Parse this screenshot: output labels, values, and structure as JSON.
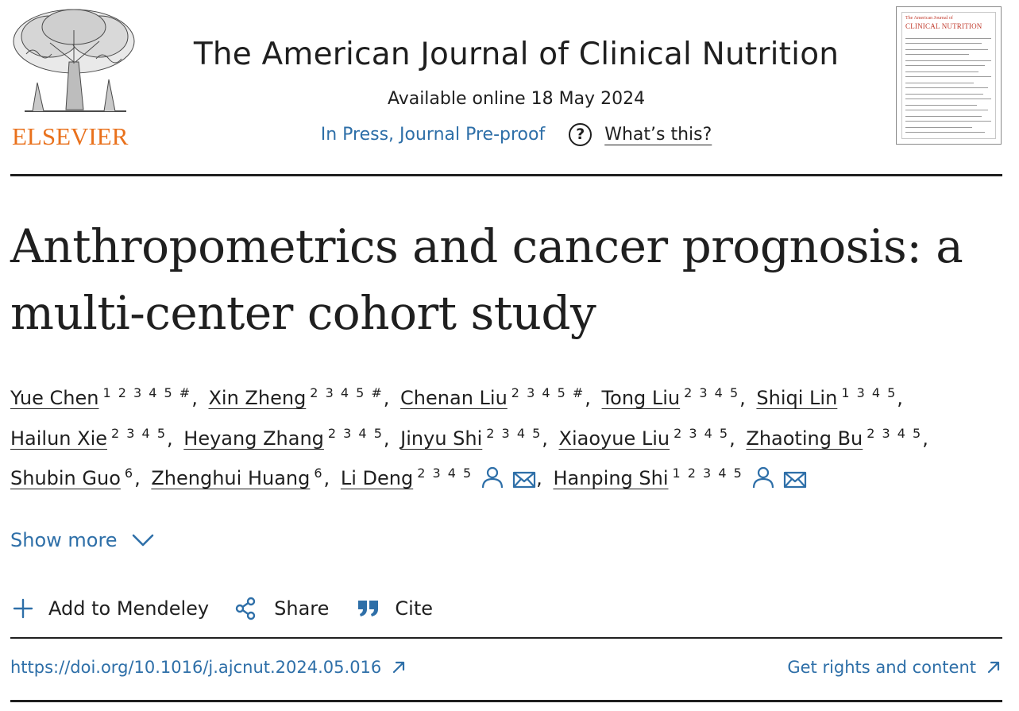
{
  "header": {
    "publisher": "ELSEVIER",
    "journal_title": "The American Journal of Clinical Nutrition",
    "available_online": "Available online 18 May 2024",
    "in_press_label": "In Press, Journal Pre-proof",
    "whats_this_label": "What’s this?",
    "help_icon_glyph": "?",
    "cover": {
      "small_title": "The American Journal of",
      "big_title": "CLINICAL NUTRITION"
    }
  },
  "article": {
    "title": "Anthropometrics and cancer prognosis: a multi-center cohort study",
    "authors": [
      {
        "name": "Yue Chen",
        "sup": "1 2 3 4 5 #",
        "icons": []
      },
      {
        "name": "Xin Zheng",
        "sup": "2 3 4 5 #",
        "icons": []
      },
      {
        "name": "Chenan Liu",
        "sup": "2 3 4 5 #",
        "icons": []
      },
      {
        "name": "Tong Liu",
        "sup": "2 3 4 5",
        "icons": []
      },
      {
        "name": "Shiqi Lin",
        "sup": "1 3 4 5",
        "icons": []
      },
      {
        "name": "Hailun Xie",
        "sup": "2 3 4 5",
        "icons": []
      },
      {
        "name": "Heyang Zhang",
        "sup": "2 3 4 5",
        "icons": []
      },
      {
        "name": "Jinyu Shi",
        "sup": "2 3 4 5",
        "icons": []
      },
      {
        "name": "Xiaoyue Liu",
        "sup": "2 3 4 5",
        "icons": []
      },
      {
        "name": "Zhaoting Bu",
        "sup": "2 3 4 5",
        "icons": []
      },
      {
        "name": "Shubin Guo",
        "sup": "6",
        "icons": []
      },
      {
        "name": "Zhenghui Huang",
        "sup": "6",
        "icons": []
      },
      {
        "name": "Li Deng",
        "sup": "2 3 4 5",
        "icons": [
          "person-icon",
          "email-icon"
        ]
      },
      {
        "name": "Hanping Shi",
        "sup": "1 2 3 4 5",
        "icons": [
          "person-icon",
          "email-icon"
        ]
      }
    ],
    "show_more_label": "Show more",
    "actions": {
      "mendeley": "Add to Mendeley",
      "share": "Share",
      "cite": "Cite"
    },
    "doi_link": "https://doi.org/10.1016/j.ajcnut.2024.05.016",
    "rights_link": "Get rights and content"
  },
  "colors": {
    "link_blue": "#2e6fa8",
    "elsevier_orange": "#e9711c",
    "text": "#1f1f1f"
  },
  "icons": {
    "person": "person-icon",
    "email": "email-icon",
    "help": "help-icon",
    "chevron": "chevron-down-icon",
    "plus": "plus-icon",
    "share": "share-icon",
    "quote": "quote-icon",
    "external": "external-link-icon"
  }
}
